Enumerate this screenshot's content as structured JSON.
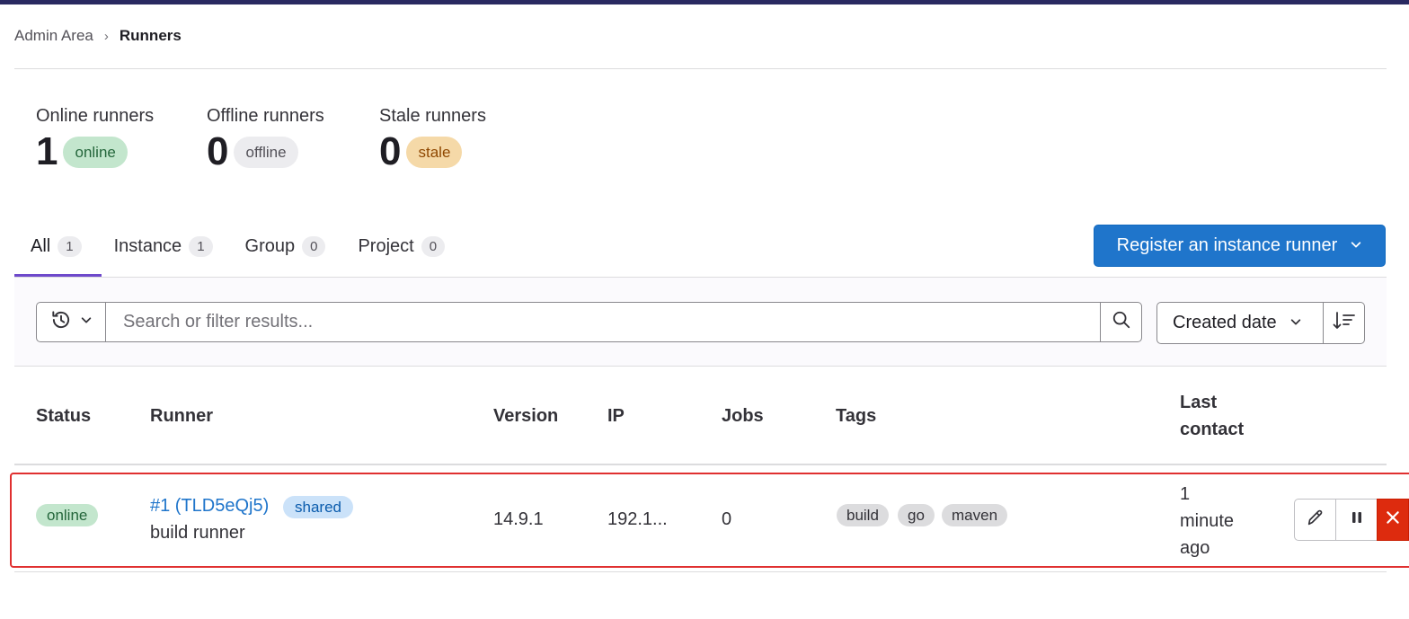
{
  "breadcrumb": {
    "parent": "Admin Area",
    "separator": "›",
    "current": "Runners"
  },
  "stats": [
    {
      "label": "Online runners",
      "count": "1",
      "badge": "online"
    },
    {
      "label": "Offline runners",
      "count": "0",
      "badge": "offline"
    },
    {
      "label": "Stale runners",
      "count": "0",
      "badge": "stale"
    }
  ],
  "tabs": [
    {
      "label": "All",
      "count": "1",
      "active": true
    },
    {
      "label": "Instance",
      "count": "1"
    },
    {
      "label": "Group",
      "count": "0"
    },
    {
      "label": "Project",
      "count": "0"
    }
  ],
  "register_button": {
    "label": "Register an instance runner",
    "icon": "chevron-down-icon"
  },
  "filter": {
    "placeholder": "Search or filter results...",
    "history_icon": "history-icon",
    "search_icon": "search-icon",
    "sort_label": "Created date",
    "sort_direction_icon": "sort-descending-icon"
  },
  "table": {
    "headers": {
      "status": "Status",
      "runner": "Runner",
      "version": "Version",
      "ip": "IP",
      "jobs": "Jobs",
      "tags": "Tags",
      "last_contact_1": "Last",
      "last_contact_2": "contact"
    },
    "rows": [
      {
        "status": "online",
        "runner_link": "#1 (TLD5eQj5)",
        "runner_type": "shared",
        "description": "build runner",
        "version": "14.9.1",
        "ip": "192.1...",
        "jobs": "0",
        "tags": [
          "build",
          "go",
          "maven"
        ],
        "last_contact": [
          "1",
          "minute",
          "ago"
        ],
        "actions": [
          "pencil-icon",
          "pause-icon",
          "close-icon"
        ]
      }
    ]
  },
  "colors": {
    "brand_blue": "#1f75cb",
    "online_bg": "#c3e6cd",
    "stale_bg": "#f5d9a8",
    "delete_red": "#dd2b0e",
    "tab_active_underline": "#6e49cb",
    "highlight_border": "#e03030"
  }
}
